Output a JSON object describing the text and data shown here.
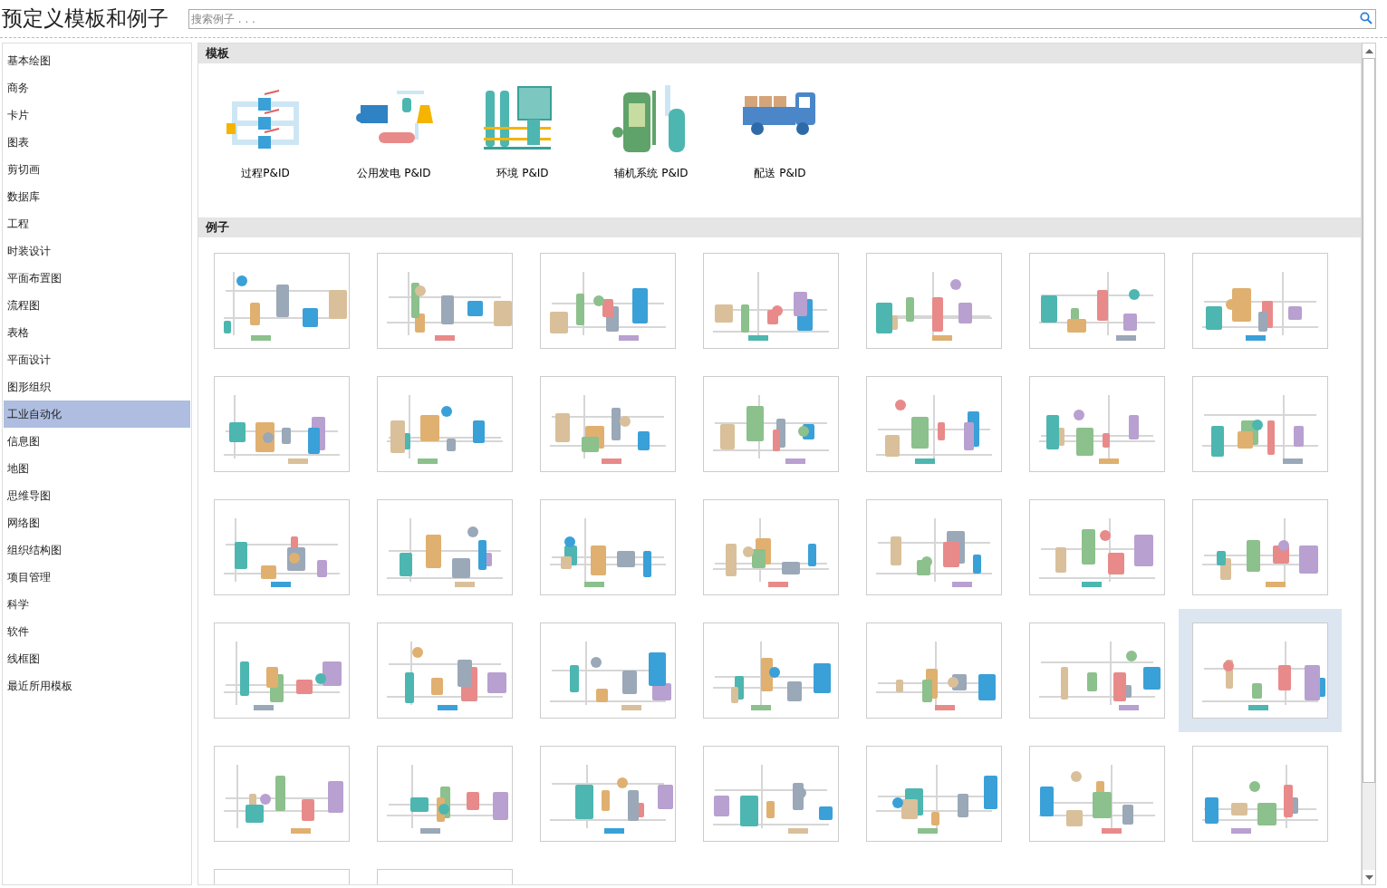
{
  "title": "预定义模板和例子",
  "search": {
    "placeholder": "搜索例子 . . ."
  },
  "sidebar": {
    "items": [
      {
        "label": "基本绘图",
        "selected": false
      },
      {
        "label": "商务",
        "selected": false
      },
      {
        "label": "卡片",
        "selected": false
      },
      {
        "label": "图表",
        "selected": false
      },
      {
        "label": "剪切画",
        "selected": false
      },
      {
        "label": "数据库",
        "selected": false
      },
      {
        "label": "工程",
        "selected": false
      },
      {
        "label": "时装设计",
        "selected": false
      },
      {
        "label": "平面布置图",
        "selected": false
      },
      {
        "label": "流程图",
        "selected": false
      },
      {
        "label": "表格",
        "selected": false
      },
      {
        "label": "平面设计",
        "selected": false
      },
      {
        "label": "图形组织",
        "selected": false
      },
      {
        "label": "工业自动化",
        "selected": true
      },
      {
        "label": "信息图",
        "selected": false
      },
      {
        "label": "地图",
        "selected": false
      },
      {
        "label": "思维导图",
        "selected": false
      },
      {
        "label": "网络图",
        "selected": false
      },
      {
        "label": "组织结构图",
        "selected": false
      },
      {
        "label": "项目管理",
        "selected": false
      },
      {
        "label": "科学",
        "selected": false
      },
      {
        "label": "软件",
        "selected": false
      },
      {
        "label": "线框图",
        "selected": false
      },
      {
        "label": "最近所用模板",
        "selected": false
      }
    ]
  },
  "templates": {
    "heading": "模板",
    "items": [
      {
        "label": "过程P&ID",
        "kind": "pipes"
      },
      {
        "label": "公用发电 P&ID",
        "kind": "power"
      },
      {
        "label": "环境 P&ID",
        "kind": "filters"
      },
      {
        "label": "辅机系统 P&ID",
        "kind": "boiler"
      },
      {
        "label": "配送 P&ID",
        "kind": "truck"
      }
    ]
  },
  "examples": {
    "heading": "例子",
    "items": [
      {
        "selected": false
      },
      {
        "selected": false
      },
      {
        "selected": false
      },
      {
        "selected": false
      },
      {
        "selected": false
      },
      {
        "selected": false
      },
      {
        "selected": false
      },
      {
        "selected": false
      },
      {
        "selected": false
      },
      {
        "selected": false
      },
      {
        "selected": false
      },
      {
        "selected": false
      },
      {
        "selected": false
      },
      {
        "selected": false
      },
      {
        "selected": false
      },
      {
        "selected": false
      },
      {
        "selected": false
      },
      {
        "selected": false
      },
      {
        "selected": false
      },
      {
        "selected": false
      },
      {
        "selected": false
      },
      {
        "selected": false
      },
      {
        "selected": false
      },
      {
        "selected": false
      },
      {
        "selected": false
      },
      {
        "selected": false
      },
      {
        "selected": false
      },
      {
        "selected": true
      },
      {
        "selected": false
      },
      {
        "selected": false
      },
      {
        "selected": false
      },
      {
        "selected": false
      },
      {
        "selected": false
      },
      {
        "selected": false
      },
      {
        "selected": false
      },
      {
        "selected": false
      },
      {
        "selected": false
      }
    ]
  }
}
